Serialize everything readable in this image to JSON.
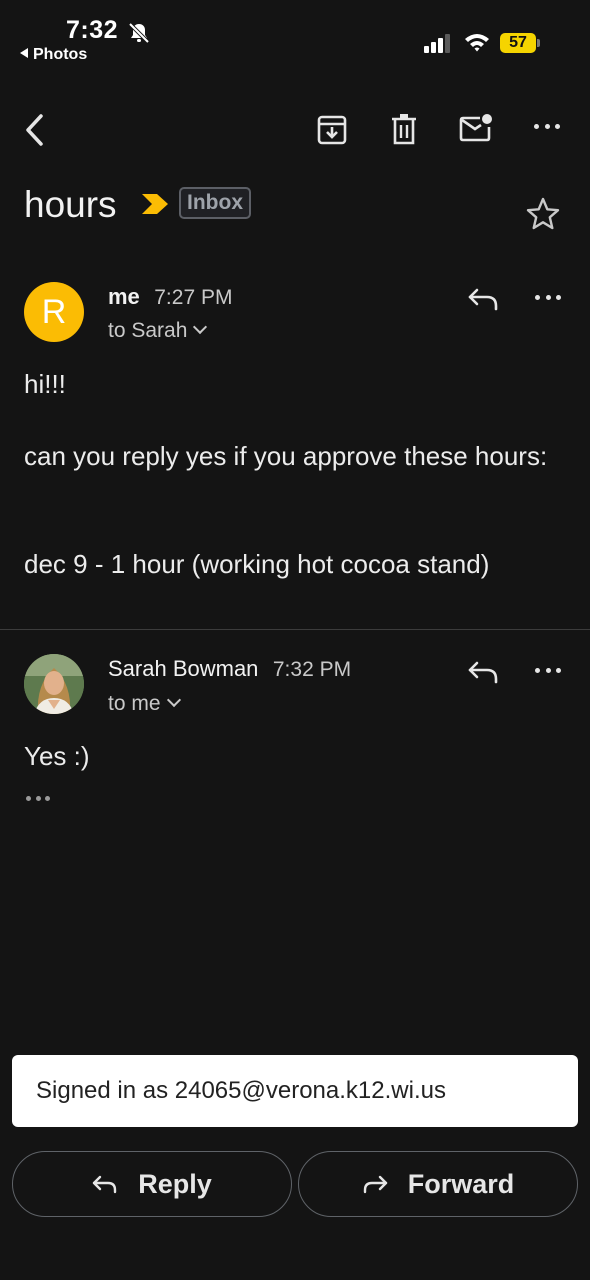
{
  "status_bar": {
    "time": "7:32",
    "back_app": "Photos",
    "battery": "57",
    "icons": [
      "bell-slash-icon",
      "cellular-signal-icon",
      "wifi-icon",
      "battery-icon"
    ]
  },
  "toolbar": {
    "icons": [
      "back-icon",
      "archive-icon",
      "delete-icon",
      "mark-unread-icon",
      "more-icon"
    ]
  },
  "thread": {
    "subject": "hours",
    "label": "Inbox",
    "colors": {
      "importance": "#fbbc04",
      "avatar": "#fbbc04"
    }
  },
  "messages": [
    {
      "avatar_letter": "R",
      "sender": "me",
      "time": "7:27 PM",
      "to": "to Sarah",
      "body_lines": [
        "hi!!!",
        "can you reply yes if you approve these hours:",
        "dec 9 - 1 hour (working hot cocoa stand)"
      ]
    },
    {
      "sender": "Sarah Bowman",
      "time": "7:32 PM",
      "to": "to me",
      "body_lines": [
        "Yes :)"
      ]
    }
  ],
  "snackbar": {
    "text": "Signed in as 24065@verona.k12.wi.us"
  },
  "actions": {
    "reply": "Reply",
    "forward": "Forward"
  }
}
